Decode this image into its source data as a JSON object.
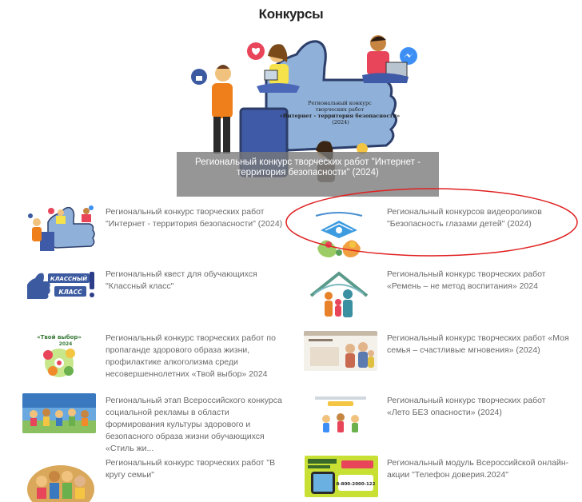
{
  "page": {
    "title": "Конкурсы"
  },
  "featured": {
    "caption": "Региональный конкурс творческих работ \"Интернет - территория безопасности\" (2024)",
    "badge_text": "Региональный конкурс творческих работ «Интернет - территория безопасности» (2024)"
  },
  "items": [
    {
      "text": "Региональный конкурс творческих работ \"Интернет - территория безопасности\" (2024)",
      "thumb": "internet-safety-thumb"
    },
    {
      "text": "Региональный конкурсов видеороликов \"Безопасность глазами детей\" (2024)",
      "thumb": "safety-eyes-thumb"
    },
    {
      "text": "Региональный квест для обучающихся \"Классный класс\"",
      "thumb": "class-class-thumb",
      "thumb_text_1": "КЛАССНЫЙ",
      "thumb_text_2": "КЛАСС"
    },
    {
      "text": "Региональный конкурс творческих работ «Ремень – не метод воспитания» 2024",
      "thumb": "belt-family-thumb"
    },
    {
      "text": "Региональный конкурс творческих работ по пропаганде здорового образа жизни, профилактике алкоголизма среди несовершеннолетних «Твой выбор» 2024",
      "thumb": "your-choice-thumb",
      "thumb_text_1": "«Твой выбор»",
      "thumb_text_2": "2024"
    },
    {
      "text": "Региональный конкурс творческих работ «Моя семья – счастливые мгновения» (2024)",
      "thumb": "my-family-thumb"
    },
    {
      "text": "Региональный этап Всероссийского конкурса социальной рекламы в области формирования культуры здорового и безопасного образа жизни обучающихся «Стиль жи...",
      "thumb": "lifestyle-thumb"
    },
    {
      "text": "Региональный конкурс творческих работ «Лето БЕЗ опасности» (2024)",
      "thumb": "summer-thumb"
    },
    {
      "text": "Региональный конкурс творческих работ \"В кругу семьи\"",
      "thumb": "family-circle-thumb"
    },
    {
      "text": "Региональный модуль Всероссийской онлайн-акции \"Телефон доверия.2024\"",
      "thumb": "trust-phone-thumb",
      "thumb_text_1": "8-800-2000-122"
    }
  ],
  "colors": {
    "annotation": "#e02020",
    "caption_bg": "#7a7a7a",
    "like_blue": "#3b5aa0"
  }
}
